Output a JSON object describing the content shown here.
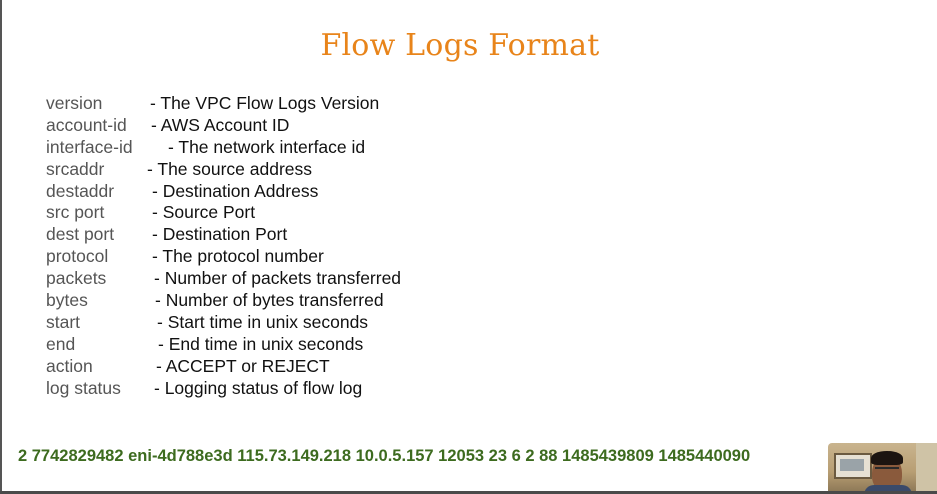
{
  "slide": {
    "title": "Flow Logs Format",
    "fields": [
      {
        "name": "version",
        "description": "- The VPC Flow Logs Version"
      },
      {
        "name": "account-id",
        "description": "- AWS Account ID"
      },
      {
        "name": "interface-id",
        "description": "- The network interface id"
      },
      {
        "name": "srcaddr",
        "description": "- The source address"
      },
      {
        "name": "destaddr",
        "description": "- Destination Address"
      },
      {
        "name": "src port",
        "description": "- Source Port"
      },
      {
        "name": "dest port",
        "description": "- Destination Port"
      },
      {
        "name": "protocol",
        "description": "- The protocol number"
      },
      {
        "name": "packets",
        "description": "- Number of packets transferred"
      },
      {
        "name": "bytes",
        "description": "- Number of bytes transferred"
      },
      {
        "name": "start",
        "description": "- Start time in unix seconds"
      },
      {
        "name": "end",
        "description": "- End time in unix seconds"
      },
      {
        "name": "action",
        "description": "- ACCEPT or REJECT"
      },
      {
        "name": "log status",
        "description": "- Logging status of flow log"
      }
    ],
    "sample_record": "2 7742829482 eni-4d788e3d 115.73.149.218 10.0.5.157 12053 23 6 2 88 1485439809 1485440090"
  },
  "colors": {
    "title": "#e8841a",
    "field_name": "#555555",
    "description": "#111111",
    "sample_record": "#3d6b1f"
  },
  "icons": {
    "webcam_overlay": "presenter-webcam"
  }
}
